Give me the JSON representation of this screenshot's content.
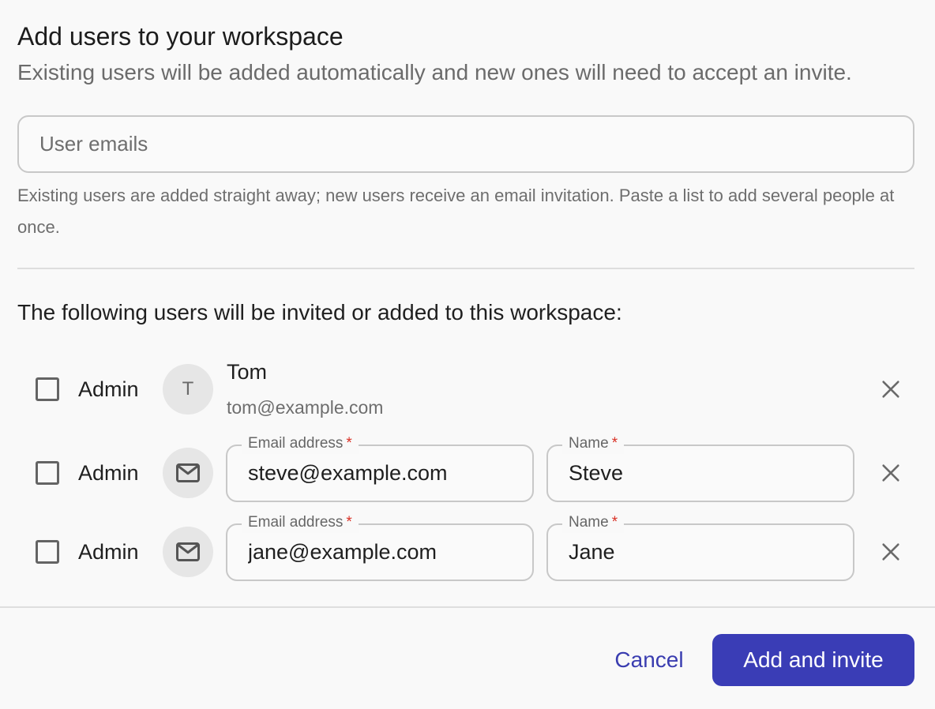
{
  "dialog": {
    "title": "Add users to your workspace",
    "subtitle": "Existing users will be added automatically and new ones will need to accept an invite."
  },
  "emails": {
    "placeholder": "User emails",
    "helper": "Existing users are added straight away; new users receive an email invitation. Paste a list to add several people at once."
  },
  "list": {
    "heading": "The following users will be invited or added to this workspace:",
    "admin_label": "Admin",
    "email_label": "Email address",
    "name_label": "Name",
    "required_mark": "*",
    "existing_user": {
      "initial": "T",
      "name": "Tom",
      "email": "tom@example.com",
      "admin": false
    },
    "new_users": [
      {
        "email": "steve@example.com",
        "name": "Steve",
        "admin": false
      },
      {
        "email": "jane@example.com",
        "name": "Jane",
        "admin": false
      }
    ]
  },
  "footer": {
    "cancel_label": "Cancel",
    "submit_label": "Add and invite"
  },
  "icons": {
    "avatar_new": "mail-icon",
    "remove": "close-icon"
  },
  "colors": {
    "primary": "#3a3db6",
    "required": "#d93025",
    "muted_text": "#6e6e6e",
    "border": "#c8c8c8"
  }
}
